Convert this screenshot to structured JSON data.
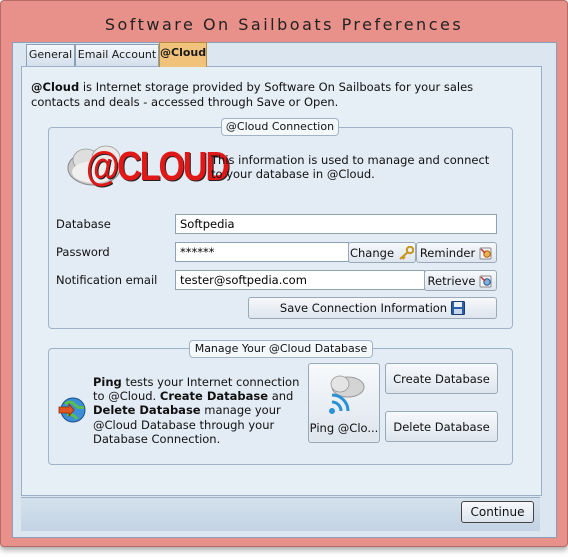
{
  "window": {
    "title": "Software On Sailboats Preferences"
  },
  "tabs": [
    {
      "label": "General"
    },
    {
      "label": "Email Account"
    },
    {
      "label": "@Cloud"
    }
  ],
  "intro": {
    "bold": "@Cloud",
    "text": " is Internet storage provided by Software On Sailboats for your sales contacts and deals - accessed through Save or Open."
  },
  "connection": {
    "legend": "@Cloud Connection",
    "logo_text": "@CLOUD",
    "info": "This information is used to manage and connect to your database in @Cloud.",
    "database_label": "Database",
    "database_value": "Softpedia",
    "password_label": "Password",
    "password_value": "******",
    "change_label": "Change",
    "reminder_label": "Reminder",
    "email_label": "Notification email",
    "email_value": "tester@softpedia.com",
    "retrieve_label": "Retrieve",
    "save_label": "Save Connection Information"
  },
  "manage": {
    "legend": "Manage Your @Cloud Database",
    "ping_bold": "Ping",
    "text1": " tests your Internet connection to @Cloud. ",
    "create_bold": "Create Database",
    "text2": " and ",
    "delete_bold": "Delete Database",
    "text3": " manage your @Cloud Database through your Database Connection.",
    "ping_button": "Ping @Clo...",
    "create_button": "Create Database",
    "delete_button": "Delete Database"
  },
  "footer": {
    "continue_label": "Continue"
  },
  "colors": {
    "window_frame": "#e8908a",
    "active_tab": "#f0c27a",
    "panel": "#dbe6f1",
    "logo_red": "#e01818"
  }
}
